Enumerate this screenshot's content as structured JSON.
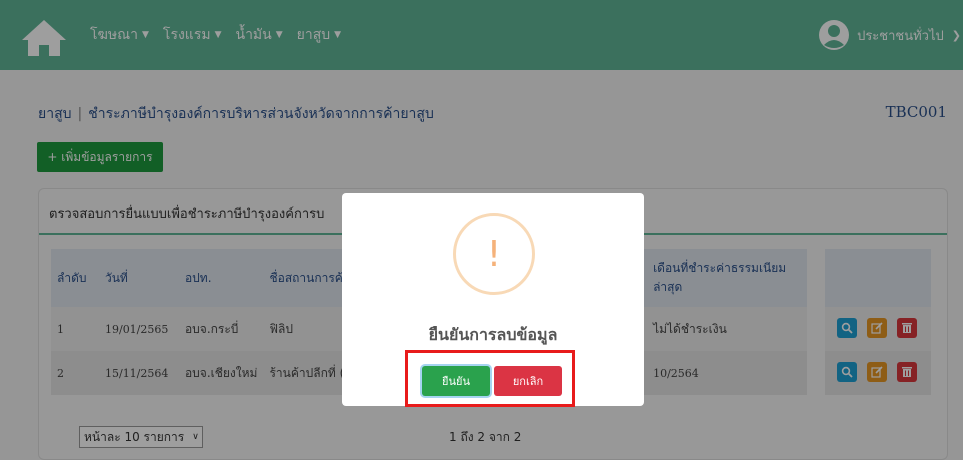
{
  "nav": {
    "items": [
      {
        "label": "โฆษณา"
      },
      {
        "label": "โรงแรม"
      },
      {
        "label": "น้ำมัน"
      },
      {
        "label": "ยาสูบ"
      }
    ],
    "user_name": "ประชาชนทั่วไป"
  },
  "breadcrumb": {
    "section": "ยาสูบ",
    "page": "ชำระภาษีบำรุงองค์การบริหารส่วนจังหวัดจากการค้ายาสูบ"
  },
  "page_code": "TBC001",
  "add_button": "+ เพิ่มข้อมูลรายการ",
  "panel": {
    "title": "ตรวจสอบการยื่นแบบเพื่อชำระภาษีบำรุงองค์การบ",
    "columns": [
      "ลำดับ",
      "วันที่",
      "อปท.",
      "ชื่อสถานการค้",
      "เดือนที่ชำระค่าธรรมเนียม ล่าสุด"
    ],
    "rows": [
      {
        "no": "1",
        "date": "19/01/2565",
        "org": "อบจ.กระบี่",
        "name": "ฟิลิป",
        "last": "ไม่ได้ชำระเงิน"
      },
      {
        "no": "2",
        "date": "15/11/2564",
        "org": "อบจ.เชียงใหม่",
        "name": "ร้านค้าปลีกที่ (",
        "last": "10/2564"
      }
    ],
    "page_size": "หน้าละ 10 รายการ",
    "page_info": "1 ถึง 2 จาก 2"
  },
  "modal": {
    "icon": "!",
    "title": "ยืนยันการลบข้อมูล",
    "confirm": "ยืนยัน",
    "cancel": "ยกเลิก"
  },
  "colors": {
    "header": "#5fb597",
    "confirm": "#2aa24d",
    "cancel": "#db3444",
    "highlight": "#e81b1b"
  }
}
